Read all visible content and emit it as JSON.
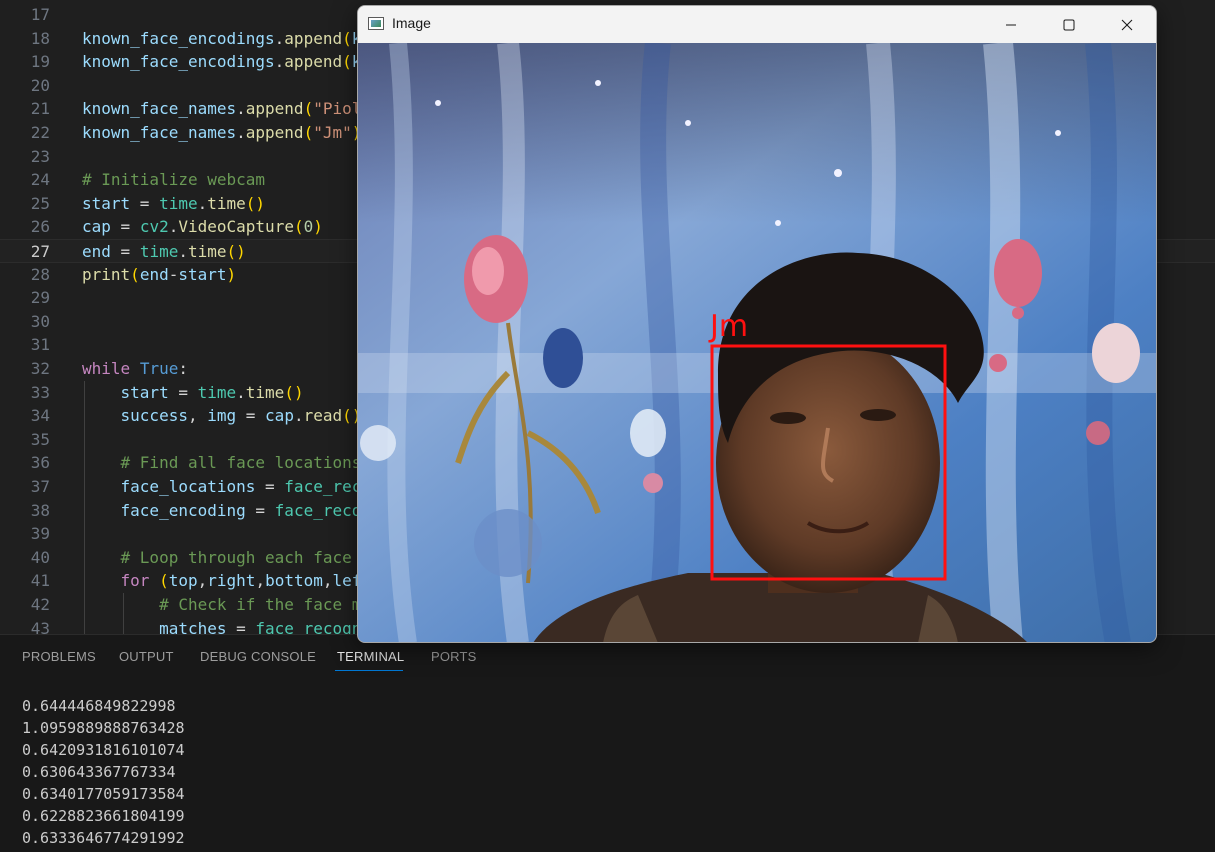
{
  "editor": {
    "active_line": "27",
    "lines": [
      {
        "n": "17",
        "tokens": []
      },
      {
        "n": "18",
        "tokens": [
          [
            "var",
            "known_face_encodings"
          ],
          [
            "op",
            "."
          ],
          [
            "fn",
            "append"
          ],
          [
            "p1",
            "("
          ],
          [
            "var",
            "k"
          ]
        ]
      },
      {
        "n": "19",
        "tokens": [
          [
            "var",
            "known_face_encodings"
          ],
          [
            "op",
            "."
          ],
          [
            "fn",
            "append"
          ],
          [
            "p1",
            "("
          ],
          [
            "var",
            "k"
          ]
        ]
      },
      {
        "n": "20",
        "tokens": []
      },
      {
        "n": "21",
        "tokens": [
          [
            "var",
            "known_face_names"
          ],
          [
            "op",
            "."
          ],
          [
            "fn",
            "append"
          ],
          [
            "p1",
            "("
          ],
          [
            "str",
            "\"Piol"
          ]
        ]
      },
      {
        "n": "22",
        "tokens": [
          [
            "var",
            "known_face_names"
          ],
          [
            "op",
            "."
          ],
          [
            "fn",
            "append"
          ],
          [
            "p1",
            "("
          ],
          [
            "str",
            "\"Jm\""
          ],
          [
            "p1",
            ")"
          ]
        ]
      },
      {
        "n": "23",
        "tokens": []
      },
      {
        "n": "24",
        "tokens": [
          [
            "cmt",
            "# Initialize webcam"
          ]
        ]
      },
      {
        "n": "25",
        "tokens": [
          [
            "var",
            "start"
          ],
          [
            "op",
            " = "
          ],
          [
            "cls",
            "time"
          ],
          [
            "op",
            "."
          ],
          [
            "fn",
            "time"
          ],
          [
            "p1",
            "()"
          ]
        ]
      },
      {
        "n": "26",
        "tokens": [
          [
            "var",
            "cap"
          ],
          [
            "op",
            " = "
          ],
          [
            "cls",
            "cv2"
          ],
          [
            "op",
            "."
          ],
          [
            "fn",
            "VideoCapture"
          ],
          [
            "p1",
            "("
          ],
          [
            "num",
            "0"
          ],
          [
            "p1",
            ")"
          ]
        ]
      },
      {
        "n": "27",
        "tokens": [
          [
            "var",
            "end"
          ],
          [
            "op",
            " = "
          ],
          [
            "cls",
            "time"
          ],
          [
            "op",
            "."
          ],
          [
            "fn",
            "time"
          ],
          [
            "p1",
            "()"
          ]
        ]
      },
      {
        "n": "28",
        "tokens": [
          [
            "fn",
            "print"
          ],
          [
            "p1",
            "("
          ],
          [
            "var",
            "end"
          ],
          [
            "op",
            "-"
          ],
          [
            "var",
            "start"
          ],
          [
            "p1",
            ")"
          ]
        ]
      },
      {
        "n": "29",
        "tokens": []
      },
      {
        "n": "30",
        "tokens": []
      },
      {
        "n": "31",
        "tokens": []
      },
      {
        "n": "32",
        "tokens": [
          [
            "kw",
            "while"
          ],
          [
            "op",
            " "
          ],
          [
            "const",
            "True"
          ],
          [
            "op",
            ":"
          ]
        ]
      },
      {
        "n": "33",
        "tokens": [
          [
            "op",
            "    "
          ],
          [
            "var",
            "start"
          ],
          [
            "op",
            " = "
          ],
          [
            "cls",
            "time"
          ],
          [
            "op",
            "."
          ],
          [
            "fn",
            "time"
          ],
          [
            "p1",
            "()"
          ]
        ]
      },
      {
        "n": "34",
        "tokens": [
          [
            "op",
            "    "
          ],
          [
            "var",
            "success"
          ],
          [
            "op",
            ", "
          ],
          [
            "var",
            "img"
          ],
          [
            "op",
            " = "
          ],
          [
            "var",
            "cap"
          ],
          [
            "op",
            "."
          ],
          [
            "fn",
            "read"
          ],
          [
            "p1",
            "()"
          ]
        ]
      },
      {
        "n": "35",
        "tokens": []
      },
      {
        "n": "36",
        "tokens": [
          [
            "op",
            "    "
          ],
          [
            "cmt",
            "# Find all face locations"
          ]
        ]
      },
      {
        "n": "37",
        "tokens": [
          [
            "op",
            "    "
          ],
          [
            "var",
            "face_locations"
          ],
          [
            "op",
            " = "
          ],
          [
            "cls",
            "face_rec"
          ]
        ]
      },
      {
        "n": "38",
        "tokens": [
          [
            "op",
            "    "
          ],
          [
            "var",
            "face_encoding"
          ],
          [
            "op",
            " = "
          ],
          [
            "cls",
            "face_reco"
          ]
        ]
      },
      {
        "n": "39",
        "tokens": []
      },
      {
        "n": "40",
        "tokens": [
          [
            "op",
            "    "
          ],
          [
            "cmt",
            "# Loop through each face "
          ]
        ]
      },
      {
        "n": "41",
        "tokens": [
          [
            "op",
            "    "
          ],
          [
            "kw",
            "for"
          ],
          [
            "op",
            " "
          ],
          [
            "p1",
            "("
          ],
          [
            "var",
            "top"
          ],
          [
            "op",
            ","
          ],
          [
            "var",
            "right"
          ],
          [
            "op",
            ","
          ],
          [
            "var",
            "bottom"
          ],
          [
            "op",
            ","
          ],
          [
            "var",
            "lef"
          ]
        ]
      },
      {
        "n": "42",
        "tokens": [
          [
            "op",
            "        "
          ],
          [
            "cmt",
            "# Check if the face m"
          ]
        ]
      },
      {
        "n": "43",
        "tokens": [
          [
            "op",
            "        "
          ],
          [
            "var",
            "matches"
          ],
          [
            "op",
            " = "
          ],
          [
            "cls",
            "face_recogn"
          ]
        ]
      }
    ]
  },
  "image_window": {
    "title": "Image",
    "icons": {
      "app": "image-window-icon",
      "minimize": "minimize-icon",
      "maximize": "maximize-icon",
      "close": "close-icon"
    },
    "detection": {
      "label": "Jm",
      "color": "#ff1010"
    }
  },
  "panel": {
    "tabs": [
      "PROBLEMS",
      "OUTPUT",
      "DEBUG CONSOLE",
      "TERMINAL",
      "PORTS"
    ],
    "active_tab": "TERMINAL",
    "terminal_lines": [
      "0.644446849822998",
      "1.0959889888763428",
      "0.6420931816101074",
      "0.630643367767334",
      "0.6340177059173584",
      "0.6228823661804199",
      "0.6333646774291992"
    ]
  },
  "colors": {
    "accent": "#0078d4",
    "editor_bg": "#1f1f1f",
    "panel_bg": "#181818"
  }
}
